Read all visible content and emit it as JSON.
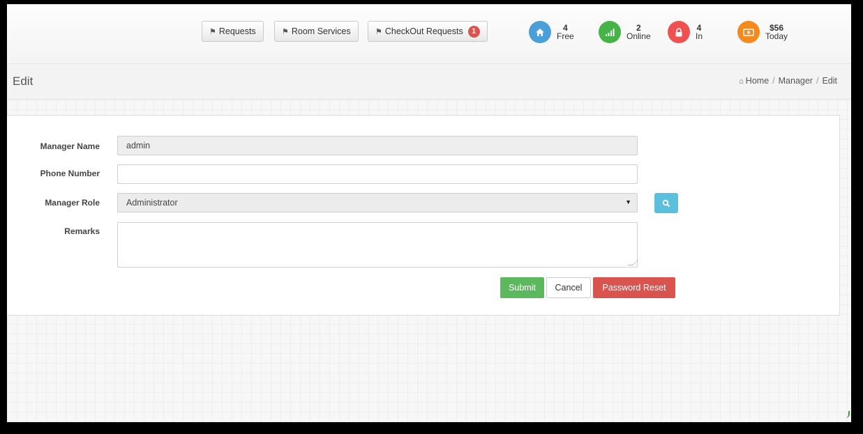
{
  "topbar": {
    "buttons": [
      {
        "label": "Requests"
      },
      {
        "label": "Room Services"
      },
      {
        "label": "CheckOut Requests",
        "badge": "1"
      }
    ],
    "stats": [
      {
        "value": "4",
        "label": "Free",
        "color": "#4a9fd8",
        "icon": "home-icon"
      },
      {
        "value": "2",
        "label": "Online",
        "color": "#46b346",
        "icon": "signal-icon"
      },
      {
        "value": "4",
        "label": "In",
        "color": "#f05050",
        "icon": "lock-icon"
      },
      {
        "value": "$56",
        "label": "Today",
        "color": "#f58a1f",
        "icon": "money-icon"
      }
    ]
  },
  "page": {
    "title": "Edit",
    "breadcrumb": [
      "Home",
      "Manager",
      "Edit"
    ]
  },
  "form": {
    "manager_name": {
      "label": "Manager Name",
      "value": "admin"
    },
    "phone": {
      "label": "Phone Number",
      "value": ""
    },
    "role": {
      "label": "Manager Role",
      "value": "Administrator"
    },
    "remarks": {
      "label": "Remarks",
      "value": ""
    },
    "submit_label": "Submit",
    "cancel_label": "Cancel",
    "reset_label": "Password Reset"
  },
  "colors": {
    "info": "#5bc0de",
    "success": "#5cb85c",
    "danger": "#d9534f"
  }
}
